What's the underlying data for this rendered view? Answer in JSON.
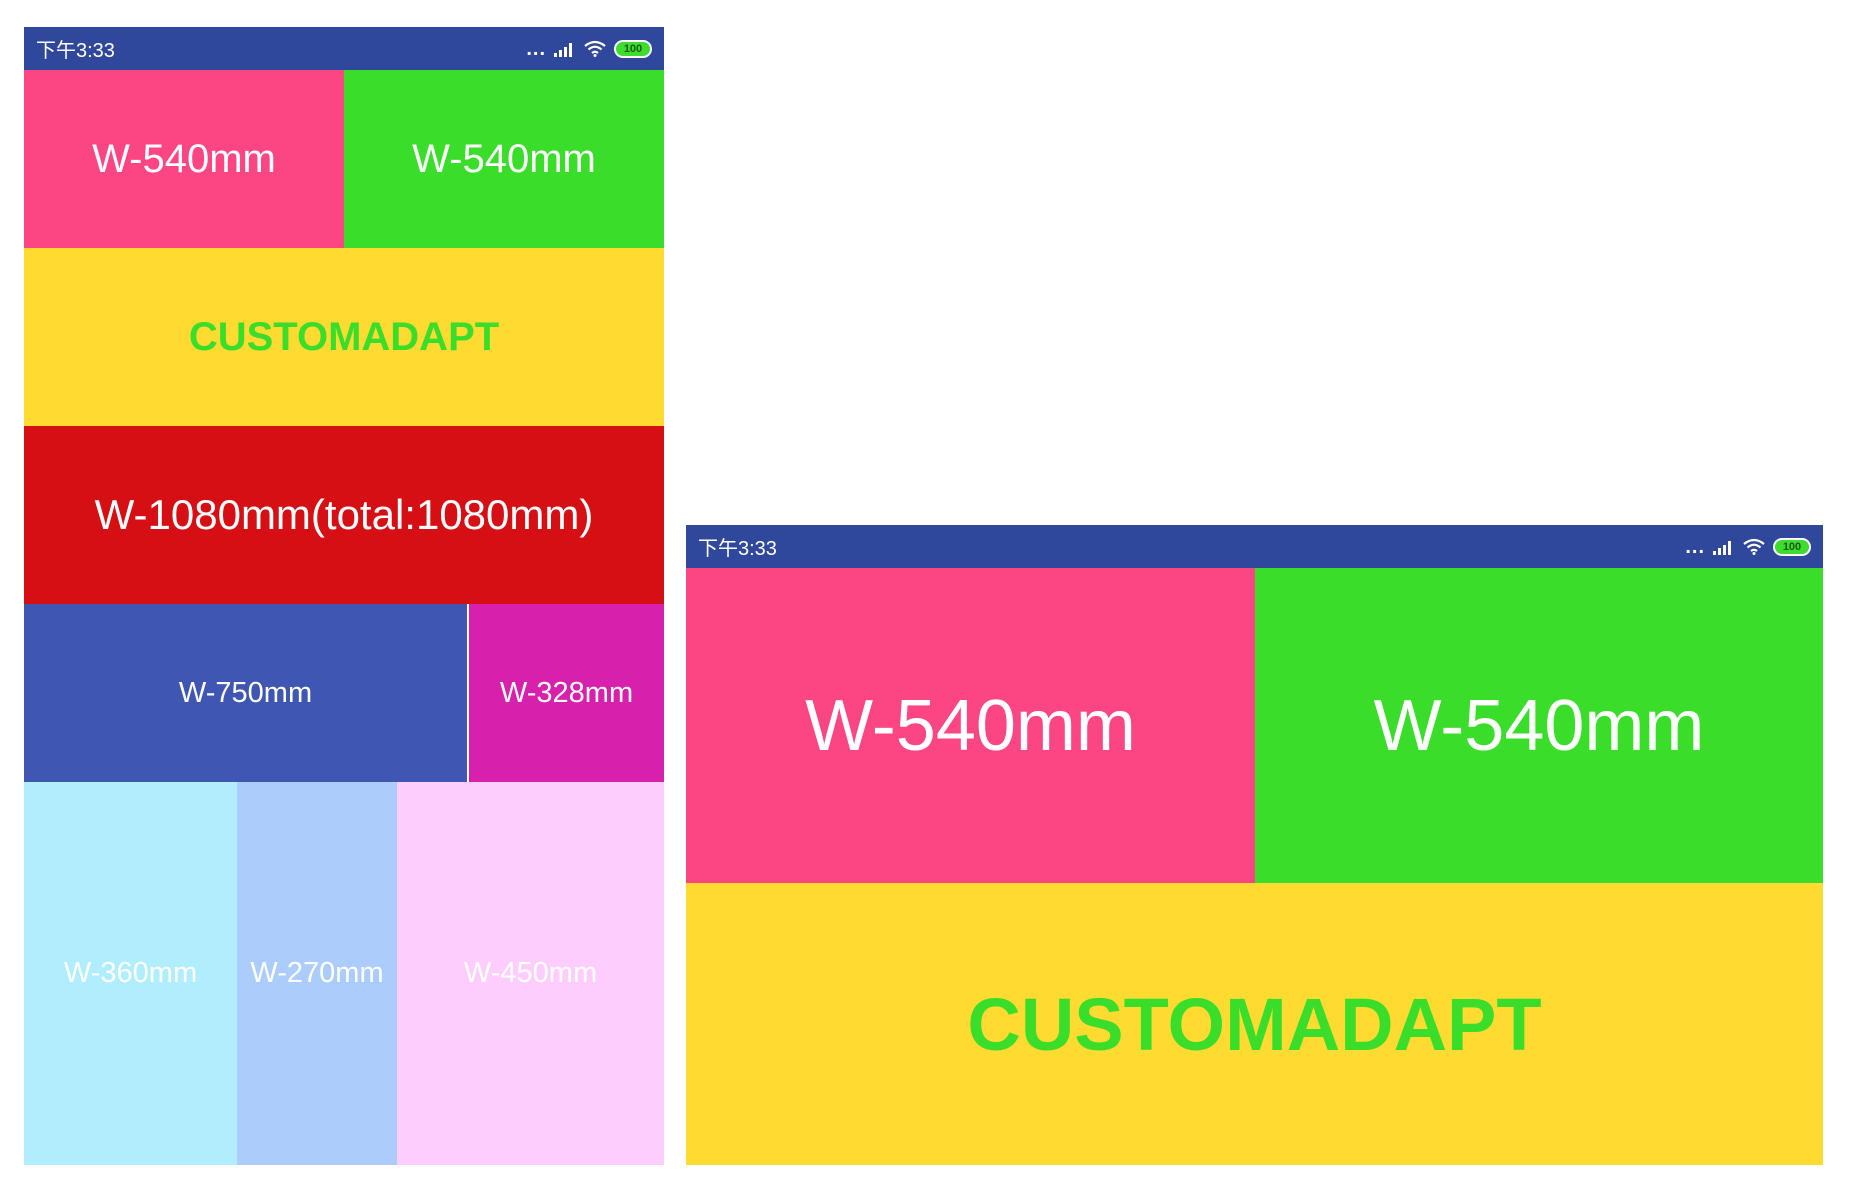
{
  "colors": {
    "statusbar": "#30489c",
    "pink": "#fc4683",
    "green": "#3bdd2b",
    "yellow": "#fedb31",
    "red": "#d60f14",
    "blue": "#3f56b2",
    "magenta": "#d720ac",
    "cyan": "#b1eefd",
    "light_blue": "#accdfc",
    "light_pink": "#fdcefd"
  },
  "portrait": {
    "status": {
      "time": "下午3:33",
      "dots": "...",
      "battery": "100",
      "icons": [
        "signal-icon",
        "wifi-icon",
        "battery-icon"
      ]
    },
    "blocks": {
      "pink": "W-540mm",
      "green": "W-540mm",
      "yellow": "CUSTOMADAPT",
      "red": "W-1080mm(total:1080mm)",
      "blue": "W-750mm",
      "magenta": "W-328mm",
      "cyan": "W-360mm",
      "light_blue": "W-270mm",
      "light_pink": "W-450mm"
    }
  },
  "landscape": {
    "status": {
      "time": "下午3:33",
      "dots": "...",
      "battery": "100",
      "icons": [
        "signal-icon",
        "wifi-icon",
        "battery-icon"
      ]
    },
    "blocks": {
      "pink": "W-540mm",
      "green": "W-540mm",
      "yellow": "CUSTOMADAPT"
    }
  }
}
